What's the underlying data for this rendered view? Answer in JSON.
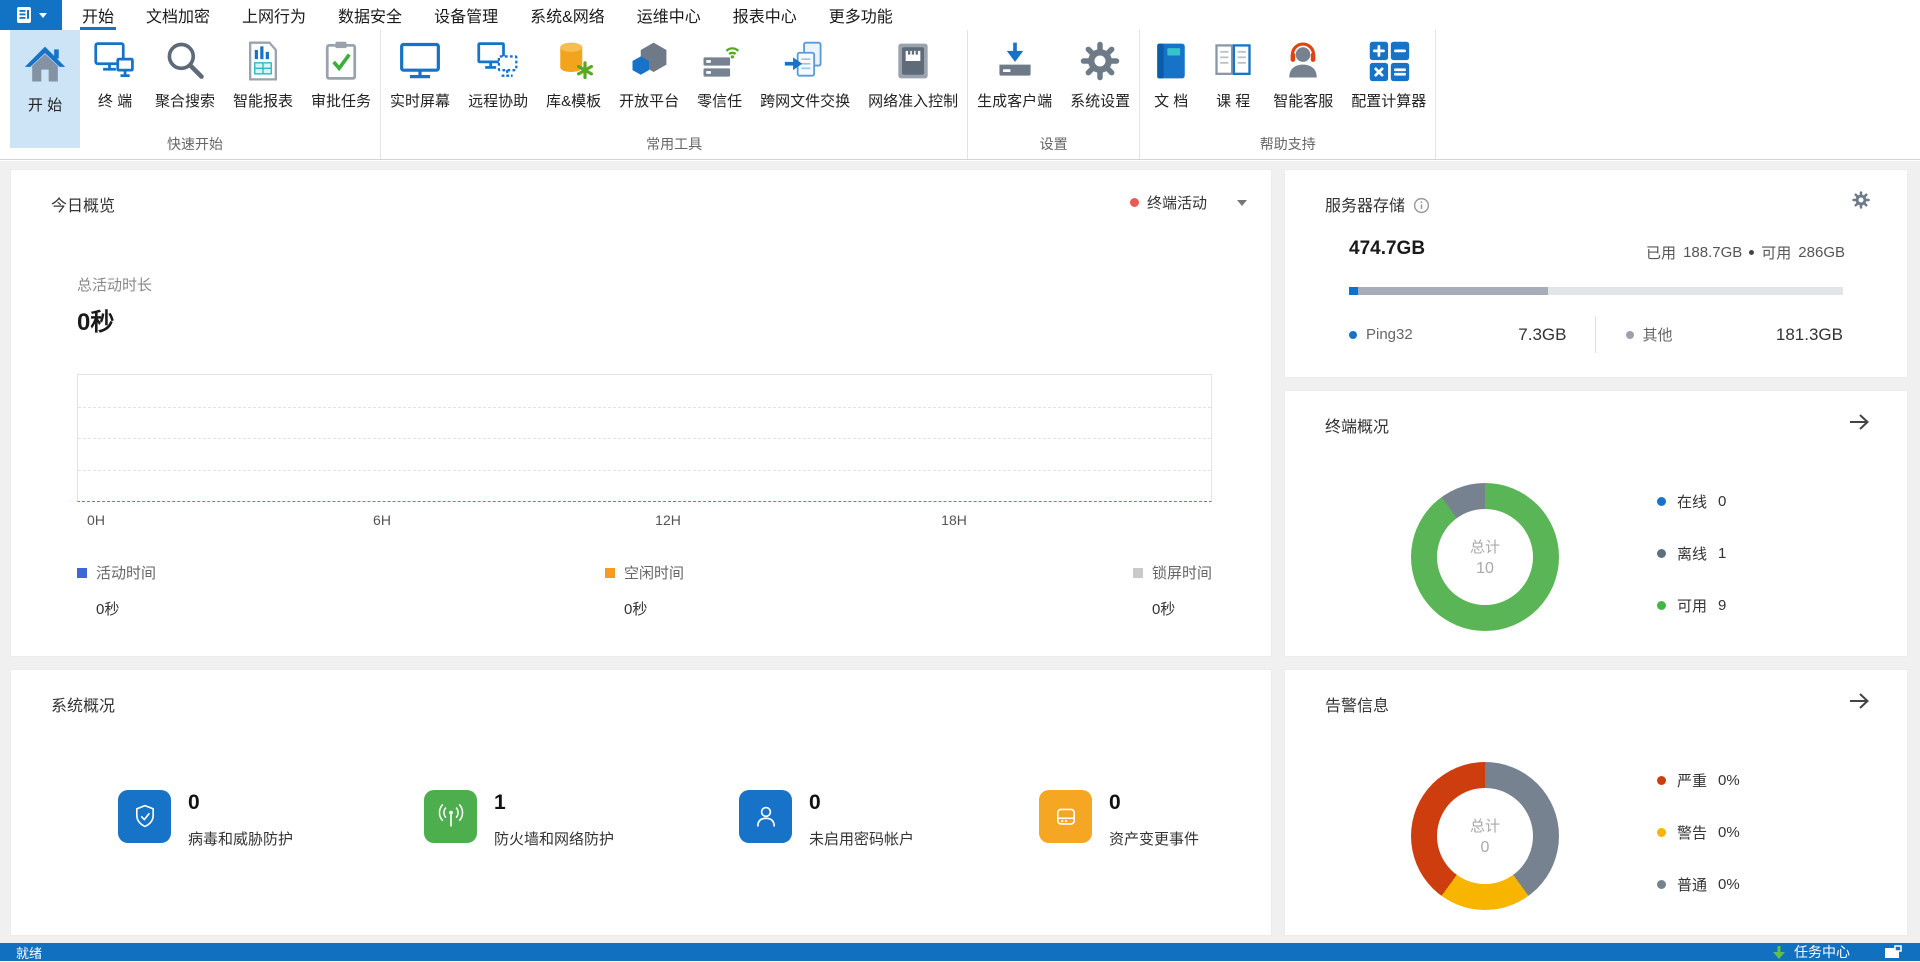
{
  "menu": {
    "tabs": [
      {
        "label": "开始",
        "active": true
      },
      {
        "label": "文档加密"
      },
      {
        "label": "上网行为"
      },
      {
        "label": "数据安全"
      },
      {
        "label": "设备管理"
      },
      {
        "label": "系统&网络"
      },
      {
        "label": "运维中心"
      },
      {
        "label": "报表中心"
      },
      {
        "label": "更多功能"
      }
    ]
  },
  "ribbon": {
    "groups": [
      {
        "label": "快速开始",
        "items": [
          {
            "label": "开 始",
            "icon": "home-icon",
            "active": true
          },
          {
            "label": "终 端",
            "icon": "terminal-icon"
          },
          {
            "label": "聚合搜索",
            "icon": "search-icon"
          },
          {
            "label": "智能报表",
            "icon": "report-icon"
          },
          {
            "label": "审批任务",
            "icon": "approval-icon"
          }
        ]
      },
      {
        "label": "常用工具",
        "items": [
          {
            "label": "实时屏幕",
            "icon": "screen-icon"
          },
          {
            "label": "远程协助",
            "icon": "remote-assist-icon"
          },
          {
            "label": "库&模板",
            "icon": "library-template-icon"
          },
          {
            "label": "开放平台",
            "icon": "open-platform-icon"
          },
          {
            "label": "零信任",
            "icon": "zero-trust-icon"
          },
          {
            "label": "跨网文件交换",
            "icon": "file-exchange-icon"
          },
          {
            "label": "网络准入控制",
            "icon": "network-access-icon"
          }
        ]
      },
      {
        "label": "设置",
        "items": [
          {
            "label": "生成客户端",
            "icon": "generate-client-icon"
          },
          {
            "label": "系统设置",
            "icon": "settings-gear-icon"
          }
        ]
      },
      {
        "label": "帮助支持",
        "items": [
          {
            "label": "文 档",
            "icon": "document-book-icon"
          },
          {
            "label": "课 程",
            "icon": "course-book-icon"
          },
          {
            "label": "智能客服",
            "icon": "support-headset-icon"
          },
          {
            "label": "配置计算器",
            "icon": "calculator-icon"
          }
        ]
      }
    ]
  },
  "today": {
    "title": "今日概览",
    "filter_label": "终端活动",
    "filter_dot_color": "#e85a55",
    "total_label": "总活动时长",
    "total_value": "0秒",
    "x_ticks": [
      "0H",
      "6H",
      "12H",
      "18H"
    ],
    "legend": [
      {
        "label": "活动时间",
        "value": "0秒",
        "color": "#3b6ad4"
      },
      {
        "label": "空闲时间",
        "value": "0秒",
        "color": "#f59b22"
      },
      {
        "label": "锁屏时间",
        "value": "0秒",
        "color": "#c9c9c9"
      }
    ]
  },
  "storage": {
    "title": "服务器存储",
    "total": "474.7GB",
    "used_label": "已用",
    "used_value": "188.7GB",
    "free_label": "可用",
    "free_value": "286GB",
    "bar_colors": {
      "ping32": "#0d72c8",
      "other_used": "#a6adb6",
      "free": "#e3e4e6"
    },
    "items": [
      {
        "label": "Ping32",
        "value": "7.3GB",
        "color": "#1673c8"
      },
      {
        "label": "其他",
        "value": "181.3GB",
        "color": "#9aa3ad"
      }
    ]
  },
  "terminals": {
    "title": "终端概况",
    "center_label": "总计",
    "center_value": "10",
    "legend": [
      {
        "label": "在线",
        "value": "0",
        "color": "#1673c8"
      },
      {
        "label": "离线",
        "value": "1",
        "color": "#5f6f80"
      },
      {
        "label": "可用",
        "value": "9",
        "color": "#44b549"
      }
    ]
  },
  "system": {
    "title": "系统概况",
    "stats": [
      {
        "value": "0",
        "label": "病毒和威胁防护",
        "icon": "shield-check-icon",
        "color": "#1673c8"
      },
      {
        "value": "1",
        "label": "防火墙和网络防护",
        "icon": "firewall-signal-icon",
        "color": "#4cae4c"
      },
      {
        "value": "0",
        "label": "未启用密码帐户",
        "icon": "user-icon",
        "color": "#1673c8"
      },
      {
        "value": "0",
        "label": "资产变更事件",
        "icon": "asset-device-icon",
        "color": "#f5a623"
      }
    ]
  },
  "alerts": {
    "title": "告警信息",
    "center_label": "总计",
    "center_value": "0",
    "legend": [
      {
        "label": "严重",
        "value": "0%",
        "color": "#ce3d0d"
      },
      {
        "label": "警告",
        "value": "0%",
        "color": "#f7b500"
      },
      {
        "label": "普通",
        "value": "0%",
        "color": "#76828f"
      }
    ]
  },
  "statusbar": {
    "ready": "就绪",
    "task_center": "任务中心",
    "bar_color": "#1170bf"
  },
  "chart_data": [
    {
      "type": "line",
      "title": "今日概览 - 终端活动",
      "xlabel": "",
      "ylabel": "",
      "x_ticks": [
        "0H",
        "6H",
        "12H",
        "18H"
      ],
      "x_range_hours": [
        0,
        24
      ],
      "grid": true,
      "series": [
        {
          "name": "活动时间",
          "total": "0秒",
          "values": []
        },
        {
          "name": "空闲时间",
          "total": "0秒",
          "values": []
        },
        {
          "name": "锁屏时间",
          "total": "0秒",
          "values": []
        }
      ],
      "note": "图表为空，所有序列总计为0秒"
    },
    {
      "type": "bar",
      "title": "服务器存储",
      "total_gb": 474.7,
      "used_gb": 188.7,
      "free_gb": 286,
      "segments": [
        {
          "name": "Ping32",
          "gb": 7.3
        },
        {
          "name": "其他",
          "gb": 181.3
        }
      ]
    },
    {
      "type": "pie",
      "title": "终端概况",
      "total": 10,
      "slices": [
        {
          "name": "在线",
          "value": 0
        },
        {
          "name": "离线",
          "value": 1
        },
        {
          "name": "可用",
          "value": 9
        }
      ],
      "legend_position": "right"
    },
    {
      "type": "pie",
      "title": "告警信息",
      "total": 0,
      "slices": [
        {
          "name": "严重",
          "value": "0%"
        },
        {
          "name": "警告",
          "value": "0%"
        },
        {
          "name": "普通",
          "value": "0%"
        }
      ],
      "legend_position": "right"
    }
  ]
}
